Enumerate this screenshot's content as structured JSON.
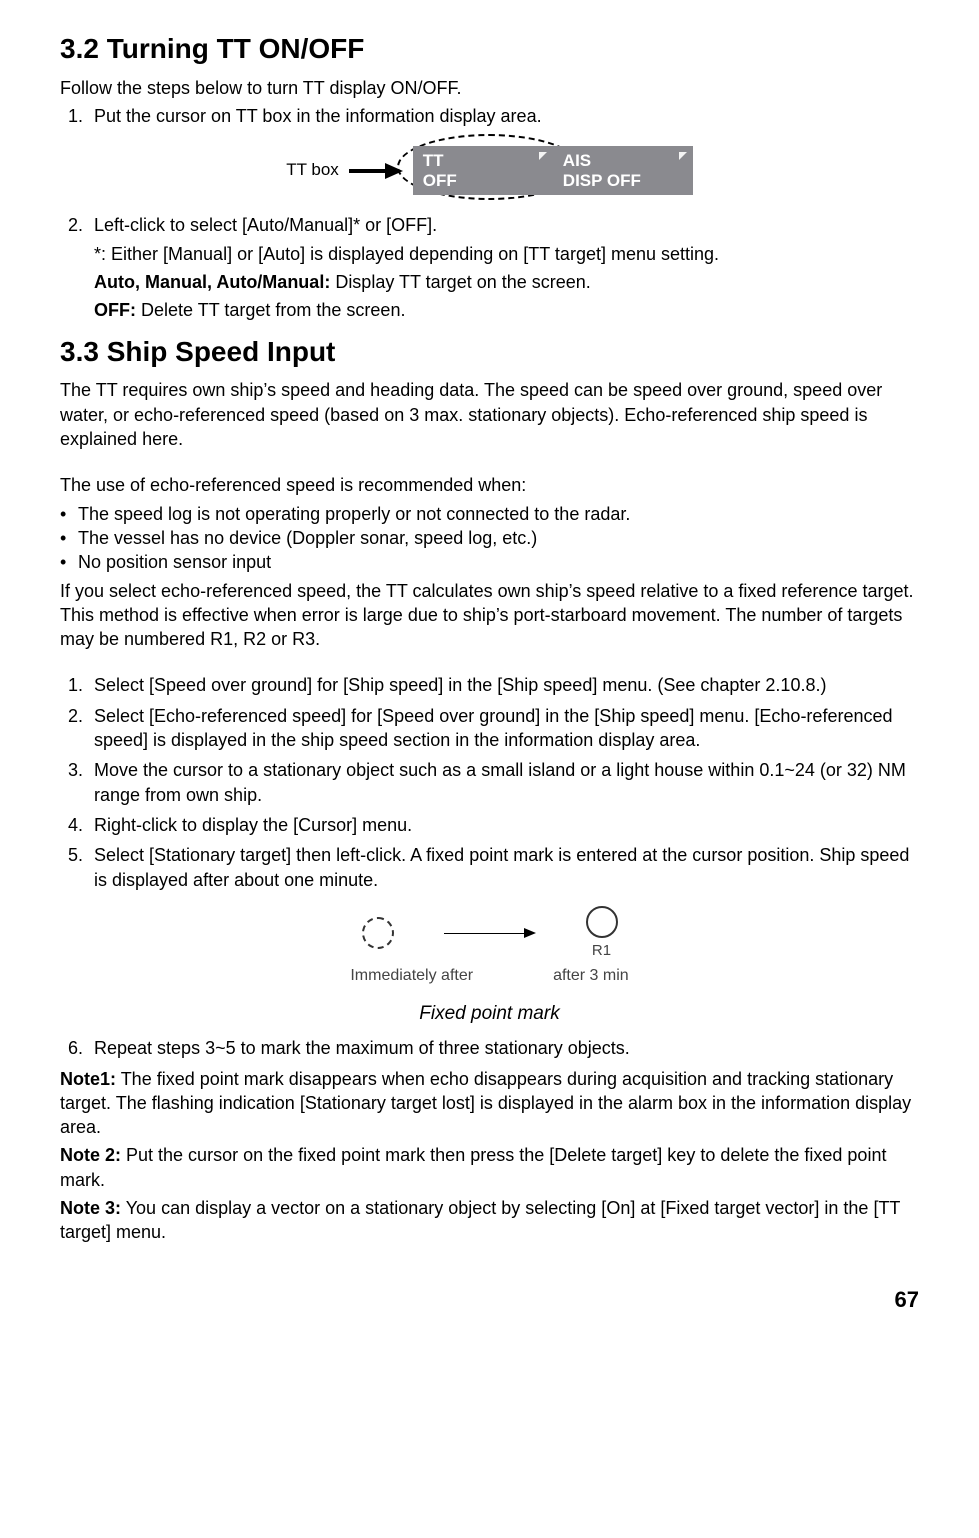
{
  "sec32": {
    "heading": "3.2  Turning TT ON/OFF",
    "intro": "Follow the steps below to turn TT display ON/OFF.",
    "step1": "Put the cursor on TT box in the information display area.",
    "fig_label": "TT box",
    "tt_line1": "TT",
    "tt_line2": "OFF",
    "ais_line1": "AIS",
    "ais_line2": "DISP OFF",
    "step2": "Left-click to select [Auto/Manual]* or [OFF].",
    "step2_note": "*: Either [Manual] or [Auto] is displayed depending on [TT target] menu setting.",
    "step2_auto_label": "Auto, Manual, Auto/Manual:",
    "step2_auto_text": " Display TT target on the screen.",
    "step2_off_label": "OFF:",
    "step2_off_text": " Delete TT target from the screen."
  },
  "sec33": {
    "heading": "3.3  Ship Speed Input",
    "p1": "The TT requires own ship’s speed and heading data. The speed can be speed over ground, speed over water, or echo-referenced speed (based on 3 max. stationary objects). Echo-referenced ship speed is explained here.",
    "p2": "The use of echo-referenced speed is recommended when:",
    "b1": "The speed log is not operating properly or not connected to the radar.",
    "b2": "The vessel has no device (Doppler sonar, speed log, etc.)",
    "b3": "No position sensor input",
    "p3": "If you select echo-referenced speed, the TT calculates own ship’s speed relative to a fixed reference target. This method is effective when error is large due to ship’s port-starboard movement. The number of targets may be numbered R1, R2 or R3.",
    "s1": "Select [Speed over ground] for [Ship speed] in the [Ship speed] menu. (See chapter 2.10.8.)",
    "s2": "Select [Echo-referenced speed] for [Speed over ground] in the [Ship speed] menu. [Echo-referenced speed] is displayed in the ship speed section in the information display area.",
    "s3": "Move the cursor to a stationary object such as a small island or a light house within 0.1~24 (or 32) NM range from own ship.",
    "s4": "Right-click to display the [Cursor] menu.",
    "s5": "Select [Stationary target] then left-click. A fixed point mark is entered at the cursor position. Ship speed is displayed after about one minute.",
    "fig2_r1": "R1",
    "fig2_left": "Immediately after",
    "fig2_right": "after 3 min",
    "fig2_caption": "Fixed point mark",
    "s6": "Repeat steps 3~5 to mark the maximum of three stationary objects.",
    "note1_label": "Note1:",
    "note1_text": " The fixed point mark disappears when echo disappears during acquisition and tracking stationary target. The flashing indication [Stationary target lost] is displayed in the alarm box in the information display area.",
    "note2_label": "Note 2:",
    "note2_text": " Put the cursor on the fixed point mark then press the [Delete target] key to delete the fixed point mark.",
    "note3_label": "Note 3:",
    "note3_text": " You can display a vector on a stationary object by selecting [On] at [Fixed target vector] in the [TT target] menu."
  },
  "page": "67"
}
